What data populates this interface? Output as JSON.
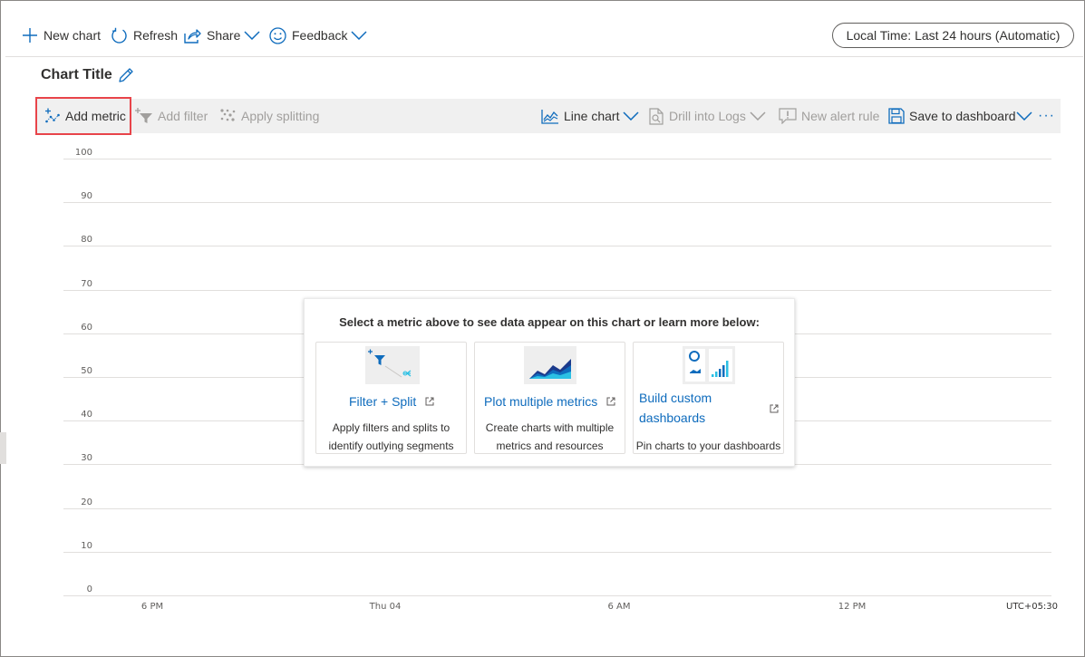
{
  "toolbar": {
    "new_chart": "New chart",
    "refresh": "Refresh",
    "share": "Share",
    "feedback": "Feedback",
    "time_range": "Local Time: Last 24 hours (Automatic)"
  },
  "chart": {
    "title": "Chart Title"
  },
  "chart_toolbar": {
    "add_metric": "Add metric",
    "add_filter": "Add filter",
    "apply_splitting": "Apply splitting",
    "line_chart": "Line chart",
    "drill_into_logs": "Drill into Logs",
    "new_alert_rule": "New alert rule",
    "save_to_dashboard": "Save to dashboard",
    "more": "···"
  },
  "chart_data": {
    "type": "line",
    "series": [],
    "y_ticks": [
      "100",
      "90",
      "80",
      "70",
      "60",
      "50",
      "40",
      "30",
      "20",
      "10",
      "0"
    ],
    "ylim": [
      0,
      100
    ],
    "x_ticks": [
      "6 PM",
      "Thu 04",
      "6 AM",
      "12 PM"
    ],
    "timezone": "UTC+05:30",
    "grid": true
  },
  "empty_state": {
    "heading": "Select a metric above to see data appear on this chart or learn more below:",
    "cards": [
      {
        "title": "Filter + Split",
        "description_line1": "Apply filters and splits to",
        "description_line2": "identify outlying segments",
        "icon": "filter-split-illustration"
      },
      {
        "title": "Plot multiple metrics",
        "description_line1": "Create charts with multiple",
        "description_line2": "metrics and resources",
        "icon": "area-chart-illustration"
      },
      {
        "title_line1": "Build custom",
        "title_line2": "dashboards",
        "description_line1": "Pin charts to your dashboards",
        "icon": "dashboard-illustration"
      }
    ]
  },
  "colors": {
    "accent": "#0f6cbd",
    "highlight_border": "#e8444a",
    "toolbar_bg": "#f0f0f0"
  }
}
